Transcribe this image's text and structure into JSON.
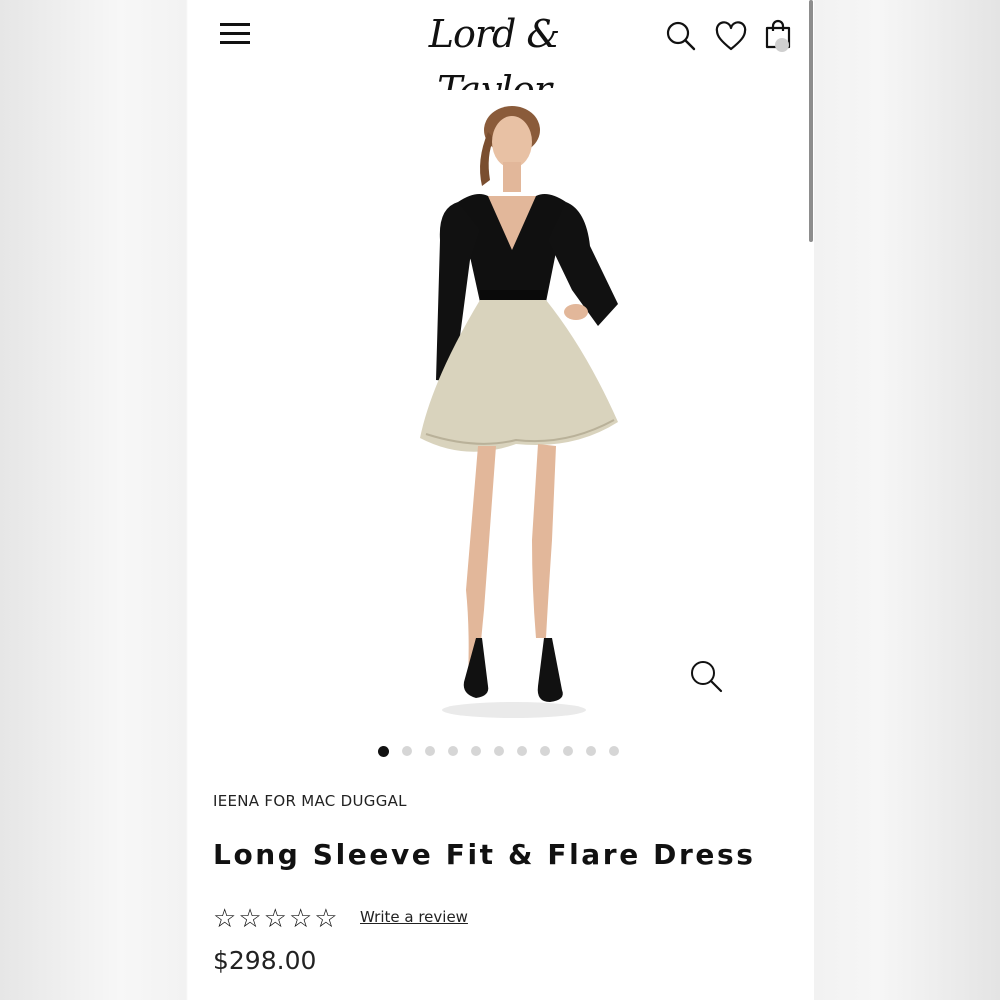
{
  "header": {
    "logo_text": "Lord & Taylor",
    "icons": [
      "menu-icon",
      "search-icon",
      "heart-icon",
      "shopping-bag-icon"
    ]
  },
  "gallery": {
    "image_description_alt": "Model wearing black long sleeve top with gold flare skirt dress",
    "total_images": 11,
    "active_index": 0
  },
  "product": {
    "brand": "IEENA FOR MAC DUGGAL",
    "title": "Long Sleeve Fit & Flare Dress",
    "rating_stars": 0,
    "write_review_label": "Write a review",
    "price": "$298.00"
  },
  "colors": {
    "accent": "#111111",
    "dot_inactive": "#d6d6d6",
    "dress_top": "#101010",
    "dress_skirt": "#d9d3bd"
  }
}
